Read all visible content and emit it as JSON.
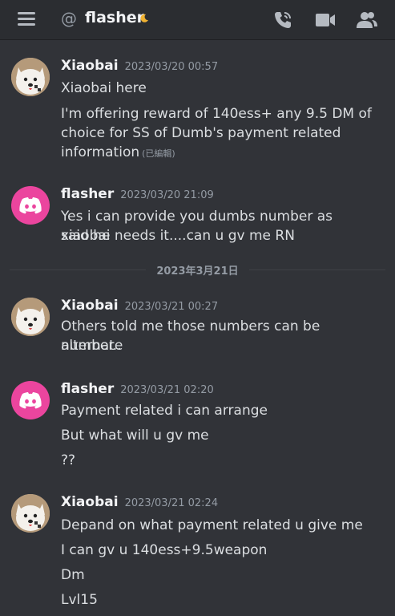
{
  "header": {
    "channel_name": "flasher"
  },
  "icons": {
    "menu": "hamburger-icon",
    "at": "at-icon",
    "status": "moon-icon",
    "call": "phone-call-icon",
    "video": "video-icon",
    "members": "members-icon"
  },
  "messages": [
    {
      "author": "Xiaobai",
      "time": "2023/03/20 00:57",
      "lines": [
        "Xiaobai here",
        "I'm offering reward of 140ess+ any 9.5 DM of",
        "choice for SS of Dumb's payment related",
        "information"
      ],
      "edited": "(已編輯)"
    },
    {
      "author": "flasher",
      "time": "2023/03/20 21:09",
      "lines": [
        "Yes i can provide you dumbs number as xiaobai",
        "said he needs it....can u gv me RN"
      ]
    },
    {
      "author": "Xiaobai",
      "time": "2023/03/21 00:27",
      "lines": [
        "Others told me those numbers can be alternate",
        "number.."
      ]
    },
    {
      "author": "flasher",
      "time": "2023/03/21 02:20",
      "lines": [
        "Payment related i can arrange",
        "But what will u gv me",
        "??"
      ]
    },
    {
      "author": "Xiaobai",
      "time": "2023/03/21 02:24",
      "lines": [
        "Depand on what payment related u give me",
        "I can gv u 140ess+9.5weapon",
        "Dm",
        "Lvl15"
      ]
    }
  ],
  "date_divider": "2023年3月21日",
  "colors": {
    "background": "#313338",
    "topbar": "#2b2d31",
    "discord_avatar": "#eb459e",
    "status_moon": "#f0b232"
  }
}
